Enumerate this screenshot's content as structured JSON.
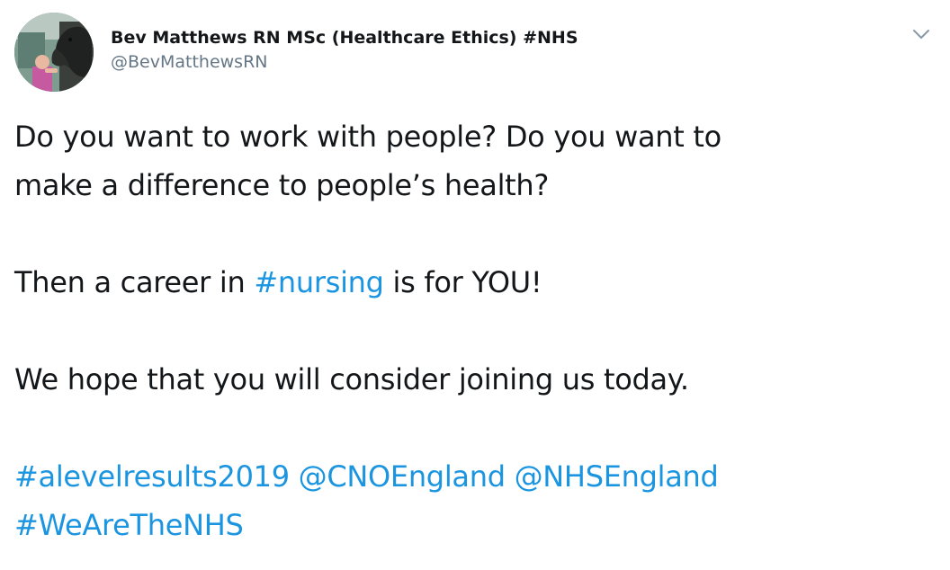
{
  "author": {
    "display_name": "Bev Matthews RN MSc (Healthcare Ethics) #NHS",
    "handle": "@BevMatthewsRN",
    "avatar_icon": "profile-photo-horse-icon"
  },
  "menu": {
    "icon": "chevron-down-icon"
  },
  "tweet": {
    "line1": "Do you want to work with people? Do you want to",
    "line2": "make a difference to people’s health?",
    "line3_prefix": "Then a career in ",
    "line3_hashtag": "#nursing",
    "line3_suffix": " is for YOU!",
    "line4": "We hope that you will consider joining us today.",
    "links": {
      "hashtag_alevel": "#alevelresults2019",
      "mention_cno": "@CNOEngland",
      "mention_nhs": "@NHSEngland",
      "hashtag_wearethenhs": "#WeAreTheNHS"
    }
  },
  "colors": {
    "text": "#14171a",
    "secondary": "#657786",
    "link": "#1b95e0"
  }
}
